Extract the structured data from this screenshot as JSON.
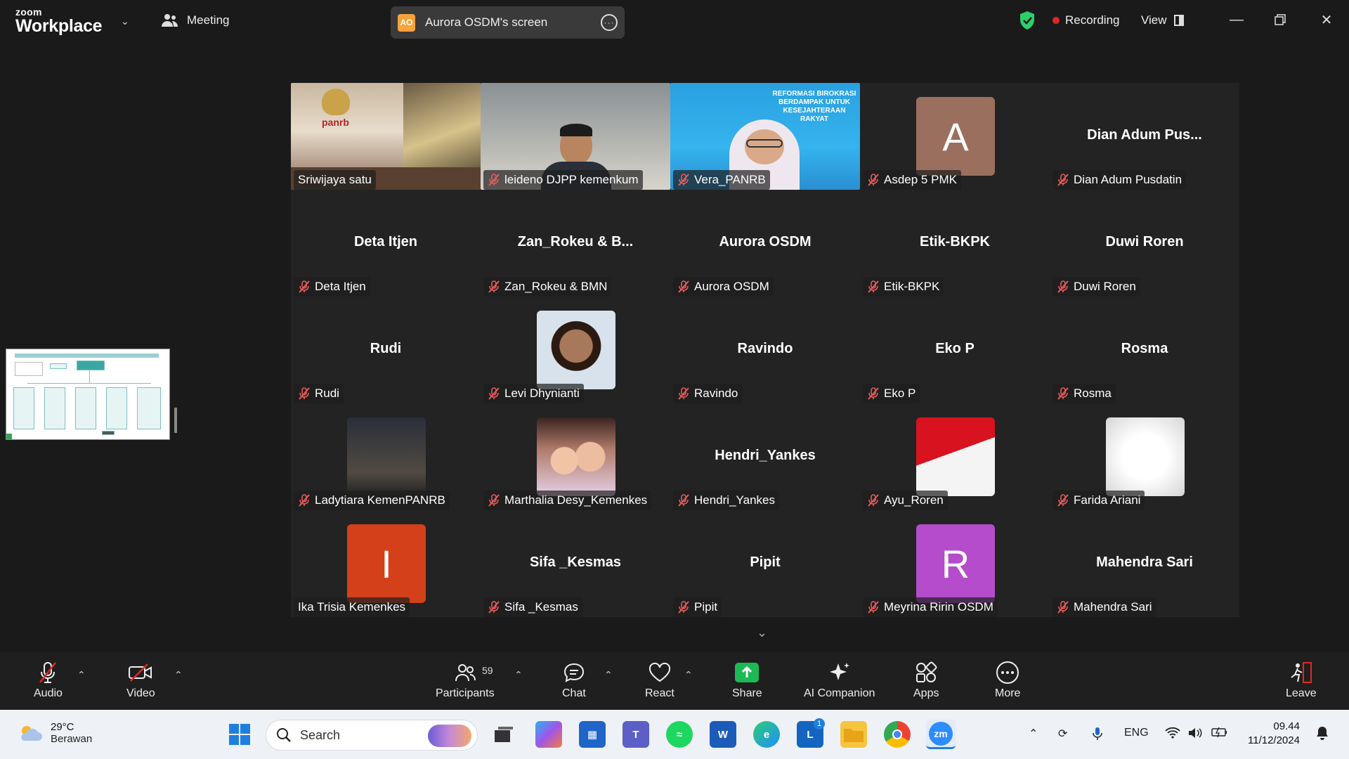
{
  "app": {
    "logo_line1": "zoom",
    "logo_line2": "Workplace",
    "meeting_label": "Meeting",
    "share_badge": "AO",
    "share_label": "Aurora OSDM's screen",
    "recording_label": "Recording",
    "view_label": "View"
  },
  "tiles": [
    {
      "big": "",
      "plate": "Sriwijaya satu",
      "type": "video",
      "muted": false,
      "active": true
    },
    {
      "big": "",
      "plate": "leideno DJPP kemenkum",
      "type": "video",
      "muted": true
    },
    {
      "big": "",
      "plate": "Vera_PANRB",
      "type": "video",
      "muted": true
    },
    {
      "big": "",
      "plate": "Asdep 5 PMK",
      "type": "avatar",
      "letter": "A",
      "color": "#9b6f5e",
      "muted": true
    },
    {
      "big": "Dian Adum Pus...",
      "plate": "Dian Adum Pusdatin",
      "type": "name",
      "muted": true
    },
    {
      "big": "Deta Itjen",
      "plate": "Deta Itjen",
      "type": "name",
      "muted": true
    },
    {
      "big": "Zan_Rokeu & B...",
      "plate": "Zan_Rokeu & BMN",
      "type": "name",
      "muted": true
    },
    {
      "big": "Aurora OSDM",
      "plate": "Aurora OSDM",
      "type": "name",
      "muted": true
    },
    {
      "big": "Etik-BKPK",
      "plate": "Etik-BKPK",
      "type": "name",
      "muted": true
    },
    {
      "big": "Duwi Roren",
      "plate": "Duwi Roren",
      "type": "name",
      "muted": true
    },
    {
      "big": "Rudi",
      "plate": "Rudi",
      "type": "name",
      "muted": true
    },
    {
      "big": "",
      "plate": "Levi Dhynianti",
      "type": "photo",
      "color": "#6b4a36",
      "muted": true
    },
    {
      "big": "Ravindo",
      "plate": "Ravindo",
      "type": "name",
      "muted": true
    },
    {
      "big": "Eko P",
      "plate": "Eko P",
      "type": "name",
      "muted": true
    },
    {
      "big": "Rosma",
      "plate": "Rosma",
      "type": "name",
      "muted": true
    },
    {
      "big": "",
      "plate": "Ladytiara KemenPANRB",
      "type": "photo",
      "color": "#3a3a3a",
      "muted": true
    },
    {
      "big": "",
      "plate": "Marthalia Desy_Kemenkes",
      "type": "photo",
      "color": "#c9998a",
      "muted": true
    },
    {
      "big": "Hendri_Yankes",
      "plate": "Hendri_Yankes",
      "type": "name",
      "muted": true
    },
    {
      "big": "",
      "plate": "Ayu_Roren",
      "type": "flag",
      "muted": true
    },
    {
      "big": "",
      "plate": "Farida Ariani",
      "type": "photo",
      "color": "#f2f2f2",
      "muted": true
    },
    {
      "big": "",
      "plate": "Ika Trisia Kemenkes",
      "type": "avatar",
      "letter": "I",
      "color": "#d4401a",
      "muted": false
    },
    {
      "big": "Sifa _Kesmas",
      "plate": "Sifa _Kesmas",
      "type": "name",
      "muted": true
    },
    {
      "big": "Pipit",
      "plate": "Pipit",
      "type": "name",
      "muted": true
    },
    {
      "big": "",
      "plate": "Meyrina Ririn OSDM",
      "type": "avatar",
      "letter": "R",
      "color": "#b44ccc",
      "muted": true
    },
    {
      "big": "Mahendra Sari",
      "plate": "Mahendra Sari",
      "type": "name",
      "muted": true
    }
  ],
  "video_text": {
    "panrb": "panrb",
    "banner_l1": "REFORMASI BIROKRASI",
    "banner_l2": "BERDAMPAK UNTUK",
    "banner_l3": "KESEJAHTERAAN RAKYAT"
  },
  "toolbar": {
    "audio": "Audio",
    "video": "Video",
    "participants": "Participants",
    "participants_count": "59",
    "chat": "Chat",
    "react": "React",
    "share": "Share",
    "ai": "AI Companion",
    "apps": "Apps",
    "more": "More",
    "leave": "Leave"
  },
  "taskbar": {
    "temp": "29°C",
    "weather": "Berawan",
    "search_placeholder": "Search",
    "lang": "ENG",
    "time": "09.44",
    "date": "11/12/2024",
    "teams_badge": "1",
    "zoom_label": "zm"
  },
  "colors": {
    "accent_green": "#2ecf6b",
    "recording_red": "#e02828",
    "share_green": "#1db954",
    "taskbar_bg": "#eef1f6"
  }
}
